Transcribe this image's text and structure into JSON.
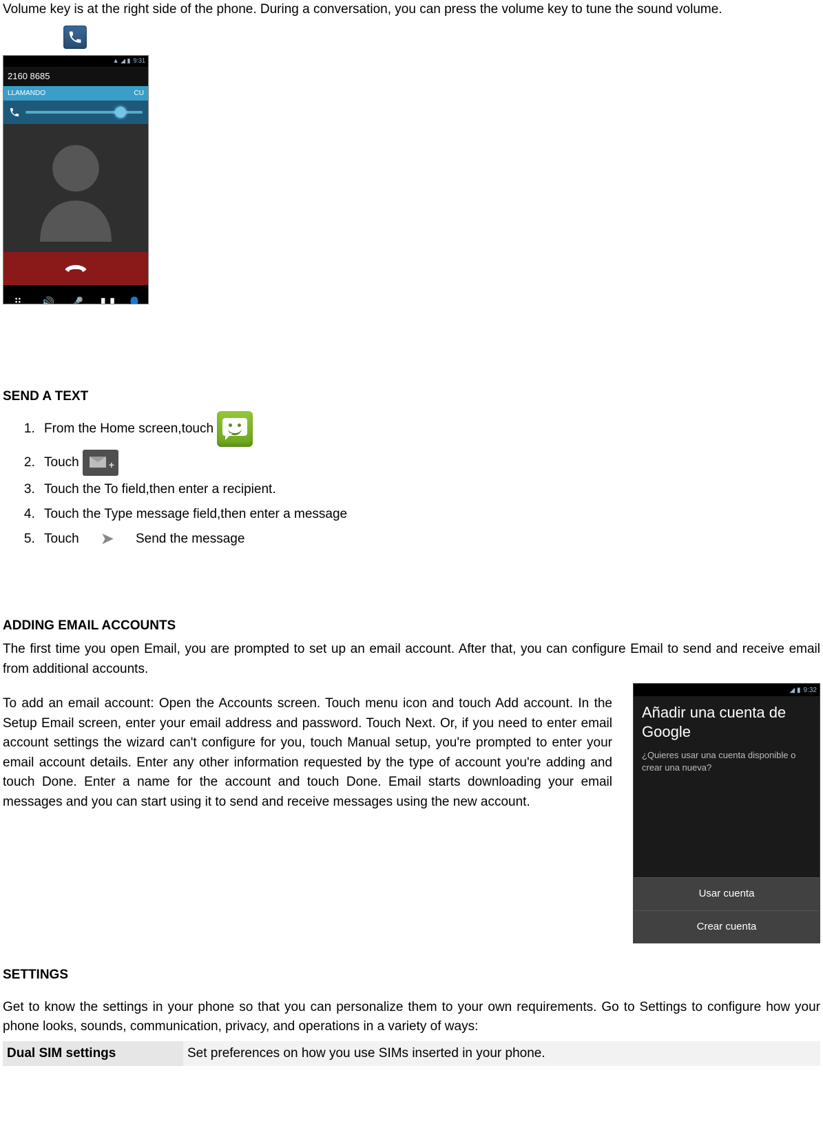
{
  "intro": "Volume key is at the right side of the phone. During a conversation, you can press the volume key to tune the sound volume.",
  "call_screen": {
    "statusbar_icons": "▲ ◢ ▮",
    "time": "9:31",
    "number": "2160 8685",
    "status": "LLAMANDO",
    "sim": "CU"
  },
  "send_text": {
    "heading": "SEND A TEXT",
    "step1": "From the Home screen,touch",
    "step2": "Touch ",
    "step3": "Touch the To field,then enter a recipient.",
    "step4": "Touch the Type message field,then enter a message",
    "step5a": "Touch",
    "step5b": "Send the message"
  },
  "email": {
    "heading": "ADDING EMAIL ACCOUNTS",
    "para1": "The first time you open Email, you are prompted to set up an email account. After that, you can configure Email to send and receive email from additional accounts.",
    "para2": "To add an email account: Open the Accounts screen. Touch menu icon and touch Add account. In the Setup Email screen, enter your email address and password. Touch Next. Or, if you need to enter email account settings the wizard can't configure for you, touch Manual setup, you're prompted to enter your email account details. Enter any other information requested by the type of account you're adding and touch Done. Enter a name for the account and touch Done. Email starts downloading your email messages and you can start using it to send and receive messages using the new account.",
    "shot": {
      "statusbar_icons": "◢ ▮",
      "time": "9:32",
      "title": "Añadir una cuenta de Google",
      "question": "¿Quieres usar una cuenta disponible o crear una nueva?",
      "btn_use": "Usar cuenta",
      "btn_create": "Crear cuenta"
    }
  },
  "settings": {
    "heading": "SETTINGS",
    "intro": "Get to know the settings in your phone so that you can personalize them to your own requirements. Go to Settings to configure how your phone looks, sounds, communication, privacy, and operations in a variety of ways:",
    "rows": [
      {
        "name": "Dual SIM settings",
        "desc": "Set preferences on how you use SIMs inserted in your phone."
      }
    ]
  }
}
